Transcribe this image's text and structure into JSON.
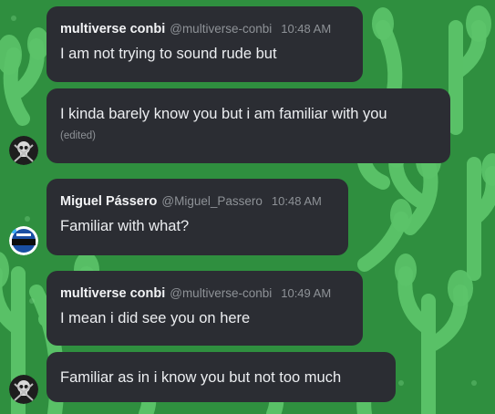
{
  "colors": {
    "bubble_bg": "#2b2d33",
    "background_green": "#2f8f3f",
    "leaf_green": "#5cc46a",
    "text_primary": "#eceef1",
    "text_muted": "#8e9297"
  },
  "messages": [
    {
      "username": "multiverse conbi",
      "handle": "@multiverse-conbi",
      "time": "10:48 AM",
      "text": "I am not trying to sound rude but"
    },
    {
      "text": "I kinda barely know you but i am familiar with you",
      "edited": "(edited)",
      "avatar_icon": "skull-avatar-icon"
    },
    {
      "username": "Miguel Pássero",
      "handle": "@Miguel_Passero",
      "time": "10:48 AM",
      "text": "Familiar with what?",
      "avatar_icon": "redacted-badge-avatar-icon"
    },
    {
      "username": "multiverse conbi",
      "handle": "@multiverse-conbi",
      "time": "10:49 AM",
      "text": "I mean i did see you on here"
    },
    {
      "text": "Familiar as in i know you but not too much",
      "avatar_icon": "skull-avatar-icon"
    }
  ]
}
